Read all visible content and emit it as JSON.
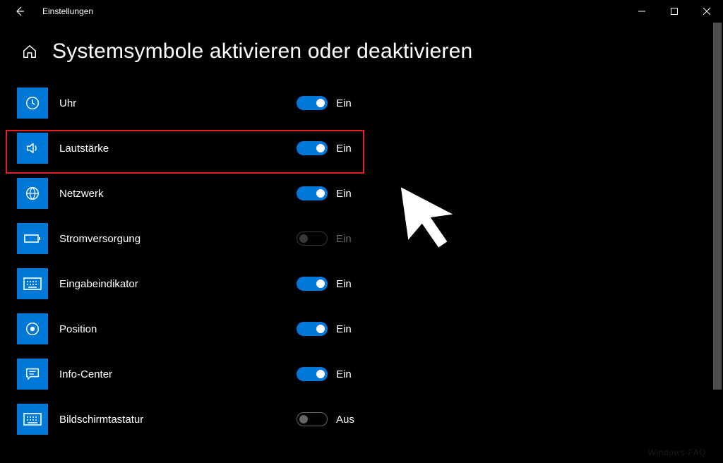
{
  "titlebar": {
    "back_title": "Einstellungen"
  },
  "page": {
    "title": "Systemsymbole aktivieren oder deaktivieren"
  },
  "labels": {
    "on": "Ein",
    "off": "Aus"
  },
  "items": [
    {
      "key": "clock",
      "label": "Uhr",
      "state": "on",
      "enabled": true,
      "icon": "clock-icon"
    },
    {
      "key": "volume",
      "label": "Lautstärke",
      "state": "on",
      "enabled": true,
      "icon": "volume-icon",
      "highlighted": true
    },
    {
      "key": "network",
      "label": "Netzwerk",
      "state": "on",
      "enabled": true,
      "icon": "globe-icon"
    },
    {
      "key": "power",
      "label": "Stromversorgung",
      "state": "on",
      "enabled": false,
      "icon": "battery-icon"
    },
    {
      "key": "input",
      "label": "Eingabeindikator",
      "state": "on",
      "enabled": true,
      "icon": "keyboard-icon"
    },
    {
      "key": "location",
      "label": "Position",
      "state": "on",
      "enabled": true,
      "icon": "location-icon"
    },
    {
      "key": "action-center",
      "label": "Info-Center",
      "state": "on",
      "enabled": true,
      "icon": "action-center-icon"
    },
    {
      "key": "touch-keyboard",
      "label": "Bildschirmtastatur",
      "state": "off",
      "enabled": true,
      "icon": "touch-keyboard-icon"
    }
  ],
  "watermark": "Windows-FAQ"
}
